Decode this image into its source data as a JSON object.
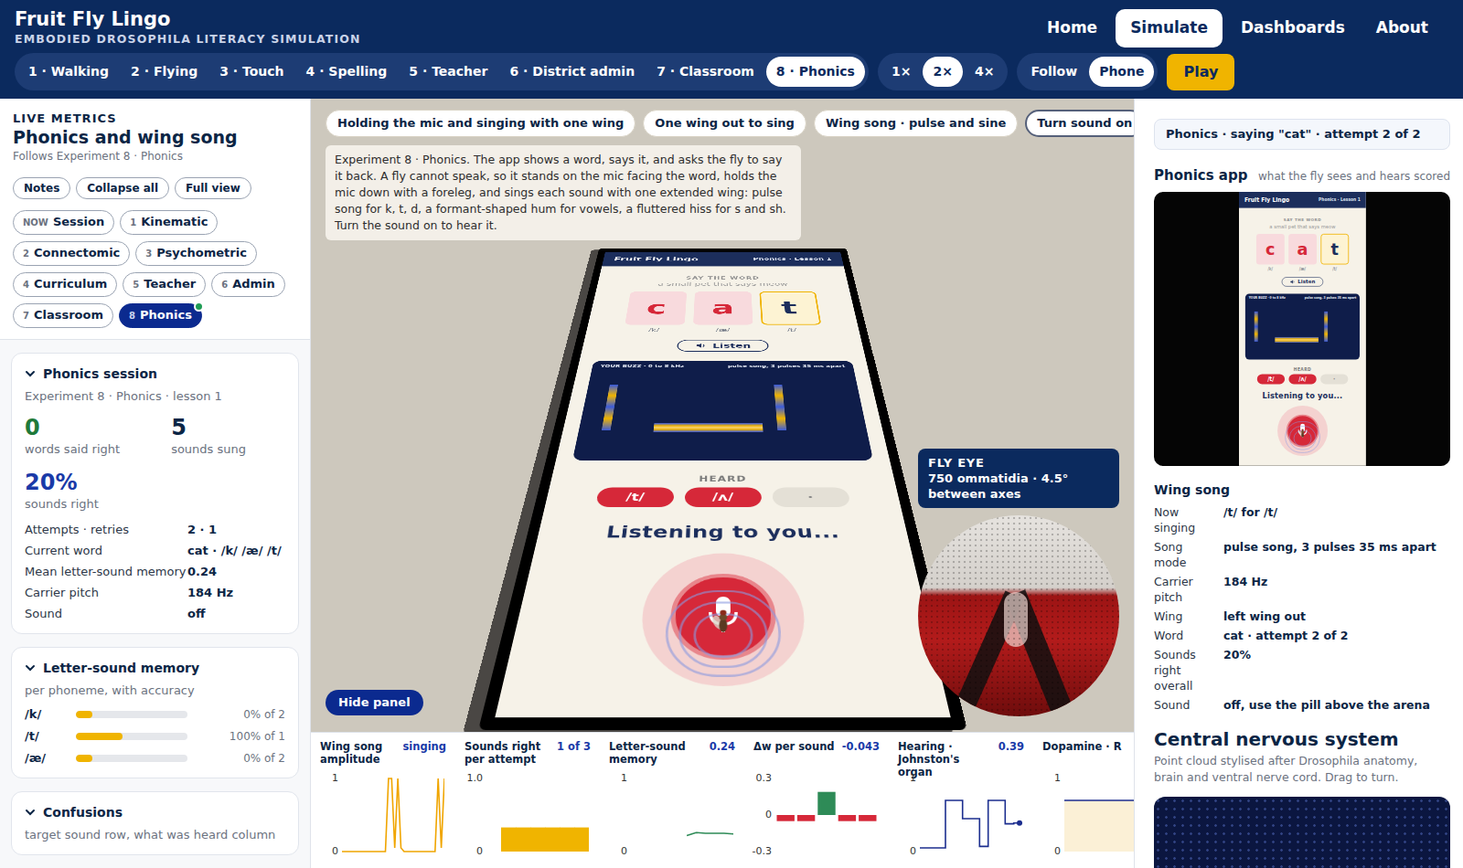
{
  "app": {
    "title": "Fruit Fly Lingo",
    "subtitle": "EMBODIED DROSOPHILA LITERACY SIMULATION"
  },
  "nav": [
    {
      "label": "Home",
      "selected": false
    },
    {
      "label": "Simulate",
      "selected": true
    },
    {
      "label": "Dashboards",
      "selected": false
    },
    {
      "label": "About",
      "selected": false
    }
  ],
  "experiments": [
    {
      "label": "1 · Walking",
      "selected": false
    },
    {
      "label": "2 · Flying",
      "selected": false
    },
    {
      "label": "3 · Touch",
      "selected": false
    },
    {
      "label": "4 · Spelling",
      "selected": false
    },
    {
      "label": "5 · Teacher",
      "selected": false
    },
    {
      "label": "6 · District admin",
      "selected": false
    },
    {
      "label": "7 · Classroom",
      "selected": false
    },
    {
      "label": "8 · Phonics",
      "selected": true
    }
  ],
  "speeds": [
    {
      "label": "1×",
      "selected": false
    },
    {
      "label": "2×",
      "selected": true
    },
    {
      "label": "4×",
      "selected": false
    }
  ],
  "views": [
    {
      "label": "Follow",
      "selected": false
    },
    {
      "label": "Phone",
      "selected": true
    }
  ],
  "play": "Play",
  "sidebar": {
    "kicker": "LIVE METRICS",
    "title": "Phonics and wing song",
    "subtitle": "Follows Experiment 8 · Phonics",
    "buttons": [
      "Notes",
      "Collapse all",
      "Full view"
    ],
    "tabs": [
      {
        "num": "NOW",
        "label": "Session",
        "selected": false,
        "dot": false
      },
      {
        "num": "1",
        "label": "Kinematic",
        "selected": false,
        "dot": false
      },
      {
        "num": "2",
        "label": "Connectomic",
        "selected": false,
        "dot": false
      },
      {
        "num": "3",
        "label": "Psychometric",
        "selected": false,
        "dot": false
      },
      {
        "num": "4",
        "label": "Curriculum",
        "selected": false,
        "dot": false
      },
      {
        "num": "5",
        "label": "Teacher",
        "selected": false,
        "dot": false
      },
      {
        "num": "6",
        "label": "Admin",
        "selected": false,
        "dot": false
      },
      {
        "num": "7",
        "label": "Classroom",
        "selected": false,
        "dot": false
      },
      {
        "num": "8",
        "label": "Phonics",
        "selected": true,
        "dot": true
      }
    ],
    "session": {
      "title": "Phonics session",
      "expanded": true,
      "subtitle": "Experiment 8 · Phonics · lesson 1",
      "stats": [
        {
          "value": "0",
          "label": "words said right",
          "color": "#1f7a3a"
        },
        {
          "value": "5",
          "label": "sounds sung",
          "color": "#0b2545"
        }
      ],
      "big": {
        "value": "20%",
        "label": "sounds right"
      },
      "rows": [
        {
          "key": "Attempts · retries",
          "value": "2 · 1"
        },
        {
          "key": "Current word",
          "value": "cat · /k/ /æ/ /t/"
        },
        {
          "key": "Mean letter-sound memory",
          "value": "0.24"
        },
        {
          "key": "Carrier pitch",
          "value": "184 Hz"
        },
        {
          "key": "Sound",
          "value": "off"
        }
      ]
    },
    "memory": {
      "title": "Letter-sound memory",
      "expanded": true,
      "subtitle": "per phoneme, with accuracy",
      "rows": [
        {
          "phoneme": "/k/",
          "level": 0.15,
          "reading": "0% of 2"
        },
        {
          "phoneme": "/t/",
          "level": 0.42,
          "reading": "100% of 1"
        },
        {
          "phoneme": "/æ/",
          "level": 0.15,
          "reading": "0% of 2"
        }
      ]
    },
    "confusions": {
      "title": "Confusions",
      "expanded": true,
      "subtitle": "target sound row, what was heard column"
    }
  },
  "arena": {
    "chips": [
      {
        "label": "Holding the mic and singing with one wing",
        "kind": "mode"
      },
      {
        "label": "One wing out to sing",
        "kind": "mode"
      },
      {
        "label": "Wing song · pulse and sine",
        "kind": "mode"
      },
      {
        "label": "Turn sound on",
        "kind": "toggle"
      }
    ],
    "description": "Experiment 8 · Phonics. The app shows a word, says it, and asks the fly to say it back. A fly cannot speak, so it stands on the mic facing the word, holds the mic down with a foreleg, and sings each sound with one extended wing: pulse song for k, t, d, a formant-shaped hum for vowels, a fluttered hiss for s and sh. Turn the sound on to hear it.",
    "hide_panel": "Hide panel",
    "eye": {
      "title": "FLY EYE",
      "detail": "750 ommatidia · 4.5° between axes"
    }
  },
  "phone": {
    "brand": "Fruit Fly Lingo",
    "lesson": "Phonics · Lesson 1",
    "prompt": "SAY THE WORD",
    "hint": "a small pet that says meow",
    "letters": [
      {
        "letter": "c",
        "phoneme": "/k/",
        "state": "done"
      },
      {
        "letter": "a",
        "phoneme": "/æ/",
        "state": "done"
      },
      {
        "letter": "t",
        "phoneme": "/t/",
        "state": "current"
      }
    ],
    "listen": "Listen",
    "buzz_label": "YOUR BUZZ · 0 to 8 kHz",
    "buzz_mode": "pulse song, 3 pulses 35 ms apart",
    "heard_label": "HEARD",
    "heard": [
      {
        "sound": "/t/",
        "filled": true
      },
      {
        "sound": "/ʌ/",
        "filled": true
      },
      {
        "sound": "·",
        "filled": false
      }
    ],
    "status": "Listening to you..."
  },
  "right": {
    "badge": "Phonics · saying \"cat\" · attempt 2 of 2",
    "app_title": "Phonics app",
    "app_caption": "what the fly sees and hears scored",
    "wing_title": "Wing song",
    "wing_rows": [
      {
        "key": "Now singing",
        "value": "/t/ for /t/"
      },
      {
        "key": "Song mode",
        "value": "pulse song, 3 pulses 35 ms apart"
      },
      {
        "key": "Carrier pitch",
        "value": "184 Hz"
      },
      {
        "key": "Wing",
        "value": "left wing out"
      },
      {
        "key": "Word",
        "value": "cat · attempt 2 of 2"
      },
      {
        "key": "Sounds right overall",
        "value": "20%"
      },
      {
        "key": "Sound",
        "value": "off, use the pill above the arena"
      }
    ],
    "cns_title": "Central nervous system",
    "cns_text": "Point cloud stylised after Drosophila anatomy, brain and ventral nerve cord. Drag to turn."
  },
  "charts": [
    {
      "title": "Wing song amplitude",
      "reading": "singing",
      "ticks": [
        "1",
        "0"
      ],
      "min": 0,
      "max": 1,
      "kind": "line",
      "color": "#f0a500",
      "values": [
        0,
        0,
        0,
        0,
        0,
        0,
        0,
        0,
        0,
        0,
        0,
        0,
        0,
        0,
        0,
        1,
        1,
        0.05,
        1,
        0.05,
        0,
        0,
        0,
        0,
        0,
        0,
        0,
        0,
        0,
        0,
        0,
        1,
        0.05,
        1
      ]
    },
    {
      "title": "Sounds right per attempt",
      "reading": "1 of 3",
      "ticks": [
        "1.0",
        "0"
      ],
      "min": 0,
      "max": 1,
      "kind": "columns",
      "color": "#f0b400",
      "values": [
        0,
        0.33,
        0.33,
        0.33,
        0.33,
        0.33,
        0.33
      ]
    },
    {
      "title": "Letter-sound memory",
      "reading": "0.24",
      "ticks": [
        "1",
        "0"
      ],
      "min": 0,
      "max": 1,
      "kind": "line",
      "color": "#2e8b57",
      "values": [
        null,
        null,
        null,
        null,
        null,
        null,
        0.22,
        0.26,
        0.25,
        0.25,
        0.25,
        0.24
      ]
    },
    {
      "title": "Δw per sound",
      "reading": "-0.043",
      "ticks": [
        "0.3",
        "0",
        "-0.3"
      ],
      "min": -0.3,
      "max": 0.3,
      "kind": "bars",
      "color": "#2e8b57",
      "neg_color": "#d62839",
      "values": [
        -0.05,
        -0.05,
        0.19,
        -0.05,
        -0.05
      ]
    },
    {
      "title": "Hearing · Johnston's organ",
      "reading": "0.39",
      "ticks": [
        "1",
        "0"
      ],
      "min": 0,
      "max": 1,
      "kind": "step",
      "color": "#1c2e8f",
      "values": [
        0.05,
        0.05,
        0.05,
        0.7,
        0.7,
        0.45,
        0.45,
        0.07,
        0.7,
        0.7,
        0.38,
        0.39
      ]
    },
    {
      "title": "Dopamine · R",
      "ticks": [
        "1",
        "0"
      ],
      "min": 0,
      "max": 1,
      "kind": "fill",
      "color": "#1c2e8f",
      "fill": "#fbf0d6",
      "values": [
        0.7,
        0.7,
        0.7,
        0.7
      ]
    }
  ]
}
